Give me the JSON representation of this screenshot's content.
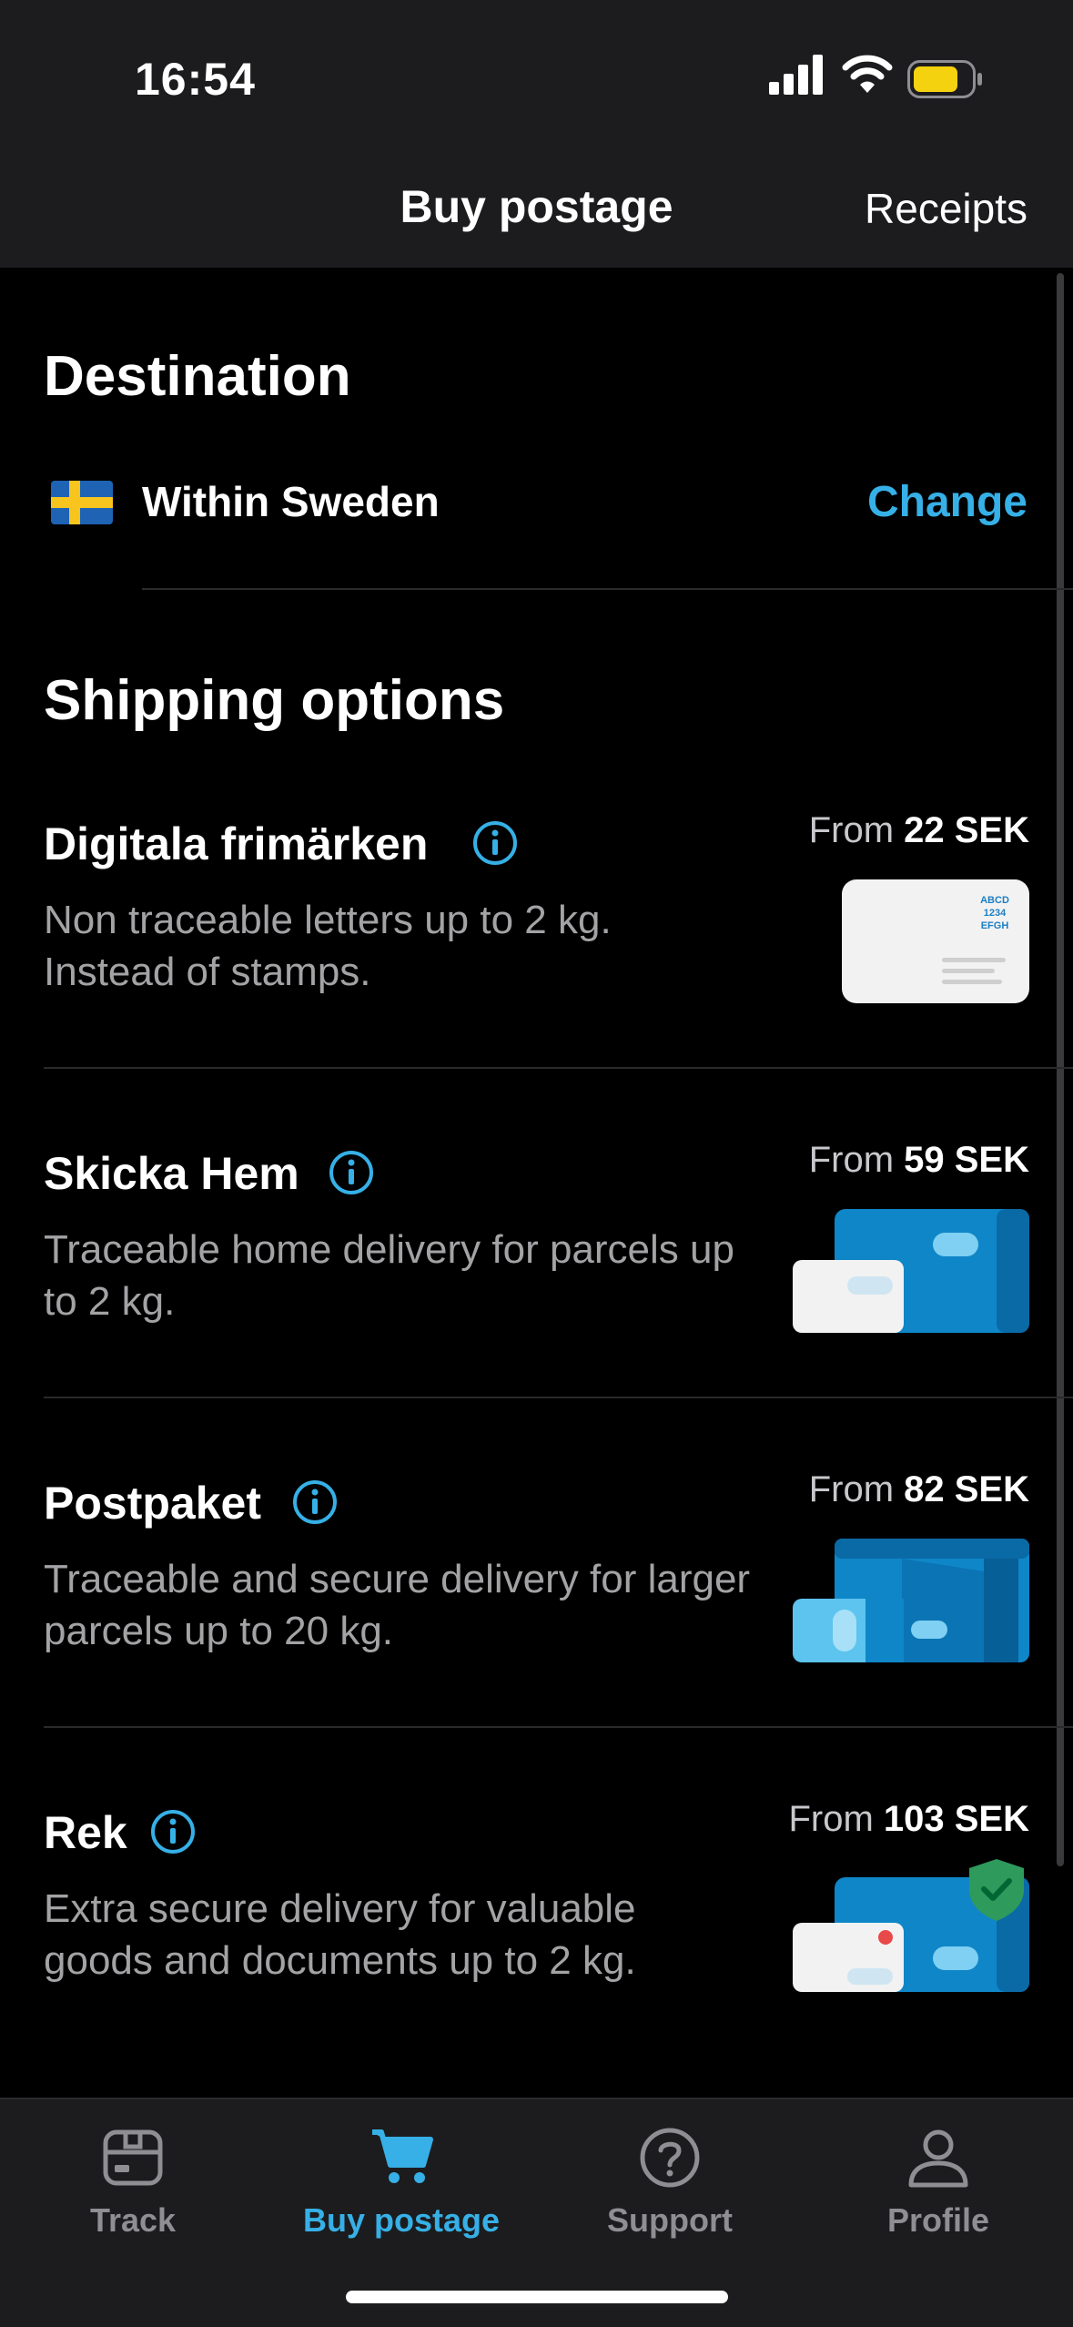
{
  "status_bar": {
    "time": "16:54"
  },
  "header": {
    "title": "Buy postage",
    "receipts_label": "Receipts"
  },
  "destination": {
    "section_title": "Destination",
    "country_label": "Within Sweden",
    "change_label": "Change"
  },
  "shipping": {
    "section_title": "Shipping options",
    "options": [
      {
        "title": "Digitala frimärken",
        "description": "Non traceable letters up to 2 kg. Instead of stamps.",
        "price_prefix": "From",
        "price": "22 SEK",
        "stamp_text": "ABCD 1234 EFGH"
      },
      {
        "title": "Skicka Hem",
        "description": "Traceable home delivery for parcels up to 2 kg.",
        "price_prefix": "From",
        "price": "59 SEK"
      },
      {
        "title": "Postpaket",
        "description": "Traceable and secure delivery for larger parcels up to 20 kg.",
        "price_prefix": "From",
        "price": "82 SEK"
      },
      {
        "title": "Rek",
        "description": "Extra secure delivery for valuable goods and documents up to 2 kg.",
        "price_prefix": "From",
        "price": "103 SEK"
      }
    ]
  },
  "tab_bar": {
    "tabs": [
      {
        "label": "Track",
        "icon": "package-icon",
        "active": false
      },
      {
        "label": "Buy postage",
        "icon": "cart-icon",
        "active": true
      },
      {
        "label": "Support",
        "icon": "question-icon",
        "active": false
      },
      {
        "label": "Profile",
        "icon": "person-icon",
        "active": false
      }
    ]
  },
  "colors": {
    "accent": "#36b0e6",
    "background": "#000000",
    "bar": "#1c1c1e",
    "battery": "#f5d20f"
  }
}
